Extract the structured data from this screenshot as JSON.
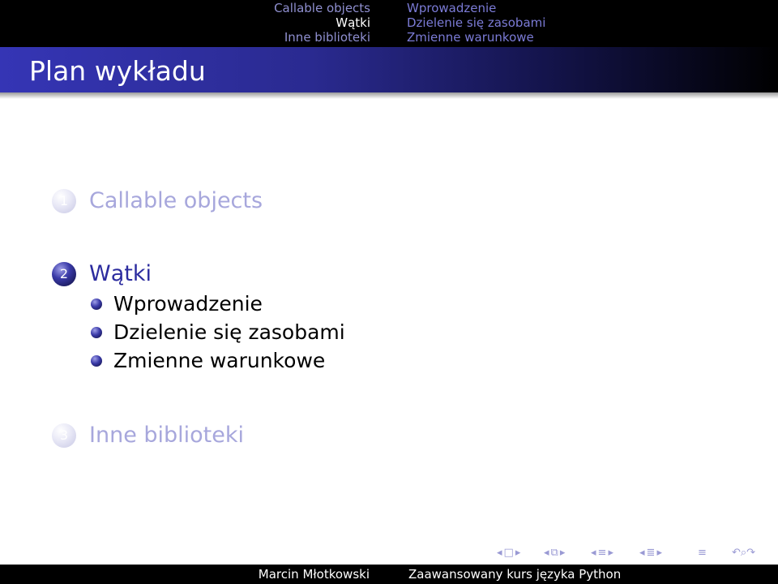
{
  "headline": {
    "sections": [
      {
        "label": "Callable objects",
        "current": false
      },
      {
        "label": "Wątki",
        "current": true
      },
      {
        "label": "Inne biblioteki",
        "current": false
      }
    ],
    "subsections": [
      {
        "label": "Wprowadzenie"
      },
      {
        "label": "Dzielenie się zasobami"
      },
      {
        "label": "Zmienne warunkowe"
      }
    ]
  },
  "frame": {
    "title": "Plan wykładu"
  },
  "toc": {
    "sections": [
      {
        "number": "1",
        "label": "Callable objects",
        "state": "shaded"
      },
      {
        "number": "2",
        "label": "Wątki",
        "state": "active",
        "subsections": [
          "Wprowadzenie",
          "Dzielenie się zasobami",
          "Zmienne warunkowe"
        ]
      },
      {
        "number": "3",
        "label": "Inne biblioteki",
        "state": "shaded"
      }
    ]
  },
  "footer": {
    "author": "Marcin Młotkowski",
    "title": "Zaawansowany kurs języka Python"
  },
  "colors": {
    "accent": "#2c2c9f",
    "shaded": "#a7a7dc",
    "bar": "#000000"
  },
  "icons": {
    "nav": [
      "nav-left-icon",
      "frame-icon",
      "nav-right-icon",
      "subsection-icon",
      "section-icon",
      "document-icon",
      "search-icon"
    ]
  }
}
